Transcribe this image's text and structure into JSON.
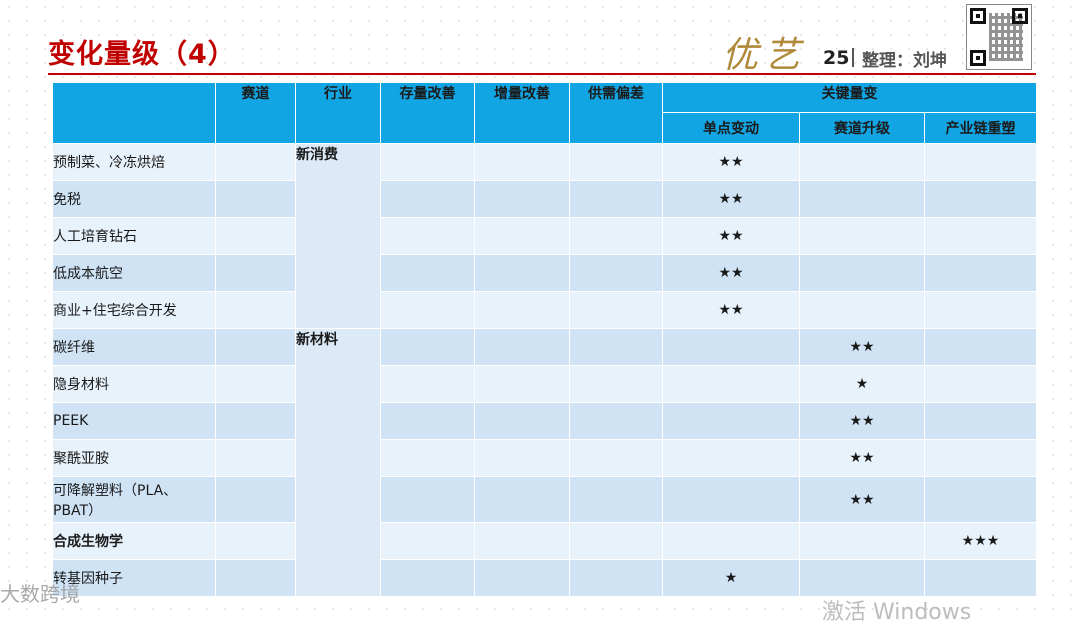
{
  "header": {
    "title": "变化量级（4）",
    "logo_text": "优艺",
    "page_number": "25",
    "compiler": "整理：刘坤"
  },
  "table": {
    "columns": [
      "赛道",
      "行业",
      "存量改善",
      "增量改善",
      "供需偏差",
      "关键量变"
    ],
    "sub_columns": [
      "单点变动",
      "赛道升级",
      "产业链重塑"
    ],
    "industries": [
      "新消费",
      "新材料"
    ],
    "rows": [
      {
        "name": "预制菜、冷冻烘焙",
        "single": "★★",
        "upgrade": "",
        "chain": ""
      },
      {
        "name": "免税",
        "single": "★★",
        "upgrade": "",
        "chain": ""
      },
      {
        "name": "人工培育钻石",
        "single": "★★",
        "upgrade": "",
        "chain": ""
      },
      {
        "name": "低成本航空",
        "single": "★★",
        "upgrade": "",
        "chain": ""
      },
      {
        "name": "商业+住宅综合开发",
        "single": "★★",
        "upgrade": "",
        "chain": ""
      },
      {
        "name": "碳纤维",
        "single": "",
        "upgrade": "★★",
        "chain": ""
      },
      {
        "name": "隐身材料",
        "single": "",
        "upgrade": "★",
        "chain": ""
      },
      {
        "name": "PEEK",
        "single": "",
        "upgrade": "★★",
        "chain": ""
      },
      {
        "name": "聚酰亚胺",
        "single": "",
        "upgrade": "★★",
        "chain": ""
      },
      {
        "name": "可降解塑料（PLA、PBAT）",
        "single": "",
        "upgrade": "★★",
        "chain": ""
      },
      {
        "name": "合成生物学",
        "single": "",
        "upgrade": "",
        "chain": "★★★"
      },
      {
        "name": "转基因种子",
        "single": "★",
        "upgrade": "",
        "chain": ""
      }
    ]
  },
  "watermarks": {
    "left": "大数跨境",
    "right": "激活 Windows"
  },
  "colors": {
    "title_red": "#c00000",
    "header_blue": "#12a5e3",
    "star_red": "#e6000a",
    "row_light": "#e8f2fb",
    "row_dark": "#cfe3f5"
  }
}
